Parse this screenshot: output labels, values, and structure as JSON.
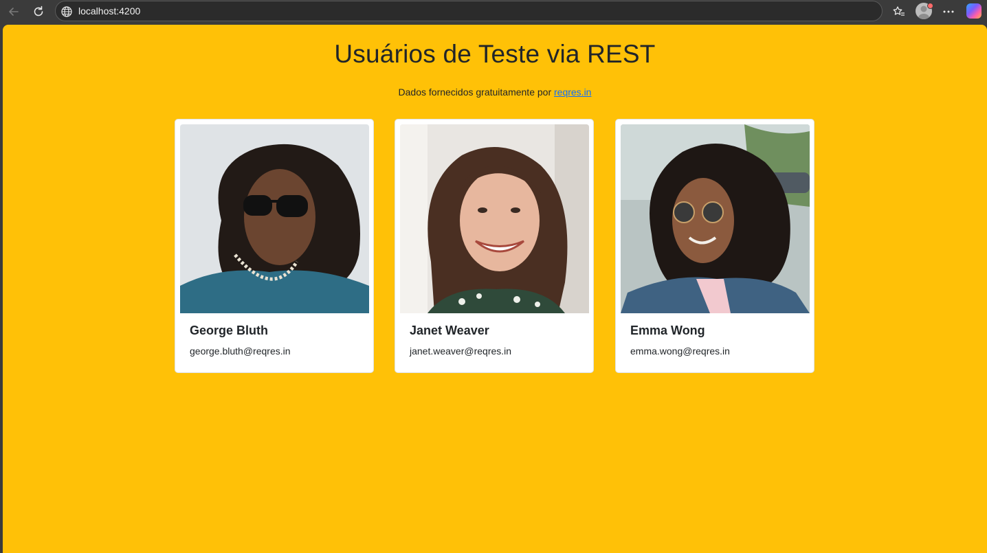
{
  "browser": {
    "url": "localhost:4200"
  },
  "page": {
    "title": "Usuários de Teste via REST",
    "subtitle_prefix": "Dados fornecidos gratuitamente por ",
    "subtitle_link": "reqres.in",
    "background_color": "#ffc107"
  },
  "users": [
    {
      "name": "George Bluth",
      "email": "george.bluth@reqres.in"
    },
    {
      "name": "Janet Weaver",
      "email": "janet.weaver@reqres.in"
    },
    {
      "name": "Emma Wong",
      "email": "emma.wong@reqres.in"
    }
  ]
}
